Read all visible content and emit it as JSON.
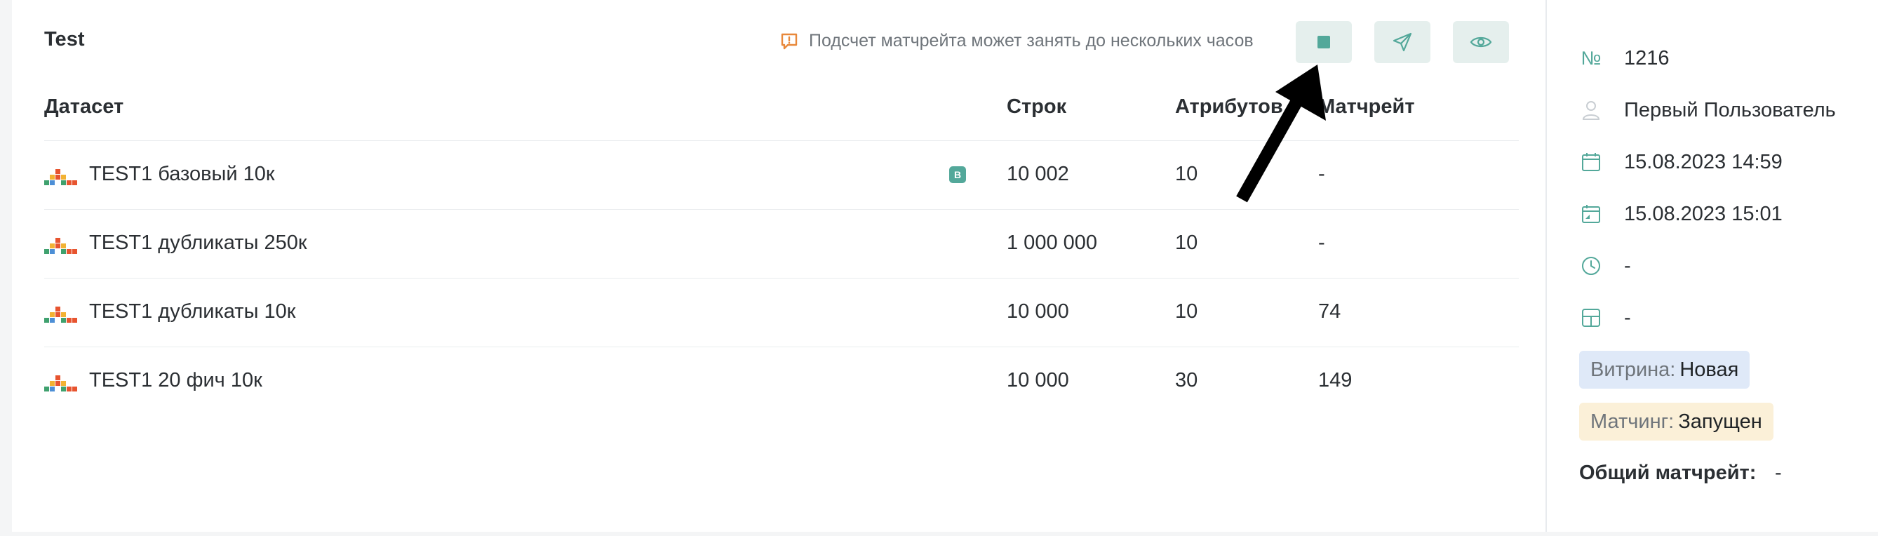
{
  "header": {
    "title": "Test",
    "notice": "Подсчет матчрейта может занять до нескольких часов"
  },
  "toolbar": {
    "buttons": [
      {
        "name": "stop",
        "icon": "stop-square-icon"
      },
      {
        "name": "send",
        "icon": "send-icon"
      },
      {
        "name": "view",
        "icon": "eye-icon"
      }
    ]
  },
  "table": {
    "columns": [
      "Датасет",
      "Строк",
      "Атрибутов",
      "Матчрейт"
    ],
    "rows": [
      {
        "name": "TEST1 базовый 10к",
        "badge": "B",
        "rows": "10 002",
        "attrs": "10",
        "match": "-"
      },
      {
        "name": "TEST1 дубликаты 250к",
        "badge": "",
        "rows": "1 000 000",
        "attrs": "10",
        "match": "-"
      },
      {
        "name": "TEST1 дубликаты 10к",
        "badge": "",
        "rows": "10 000",
        "attrs": "10",
        "match": "74"
      },
      {
        "name": "TEST1 20 фич 10к",
        "badge": "",
        "rows": "10 000",
        "attrs": "30",
        "match": "149"
      }
    ]
  },
  "sidebar": {
    "number_label": "№",
    "number": "1216",
    "user": "Первый Пользователь",
    "created": "15.08.2023 14:59",
    "updated": "15.08.2023 15:01",
    "duration": "-",
    "layout_value": "-",
    "showcase_label": "Витрина:",
    "showcase_value": "Новая",
    "matching_label": "Матчинг:",
    "matching_value": "Запущен",
    "total_label": "Общий матчрейт:",
    "total_value": "-"
  },
  "colors": {
    "accent": "#53a89a",
    "button_bg": "#e5efed",
    "notice_icon": "#e8883a",
    "showcase_bg": "#dfe9f8",
    "matching_bg": "#fbf0d8"
  }
}
